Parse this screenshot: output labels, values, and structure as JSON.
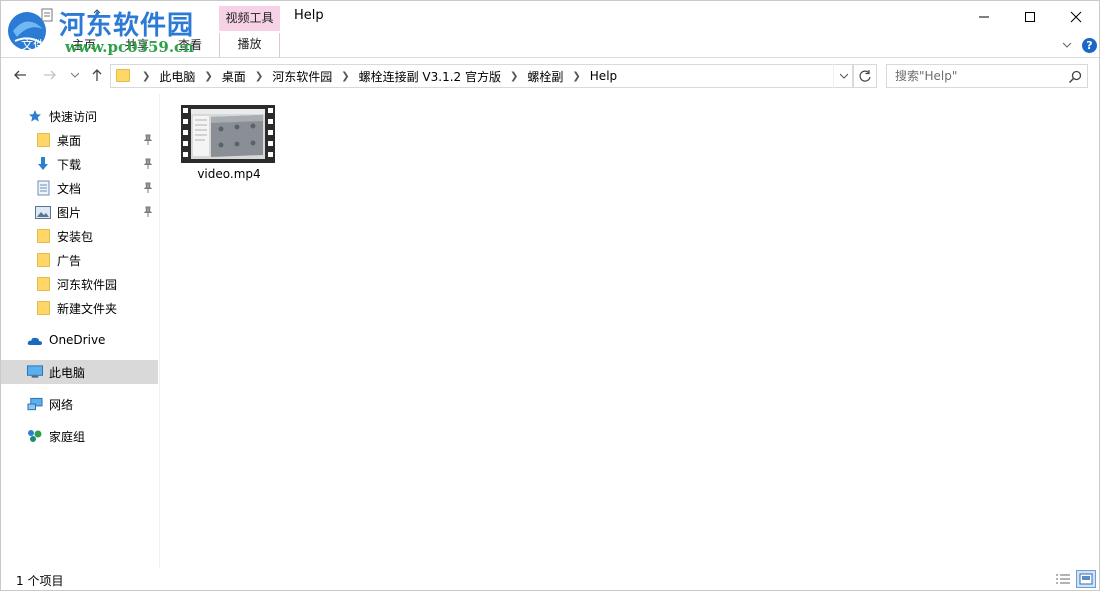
{
  "window": {
    "title": "Help",
    "context_tab_group": "视频工具",
    "watermark": {
      "name": "河东软件园",
      "url": "www.pc0359.cn"
    }
  },
  "ribbon": {
    "tabs": [
      {
        "label": "文件"
      },
      {
        "label": "主页"
      },
      {
        "label": "共享"
      },
      {
        "label": "查看"
      },
      {
        "label": "播放"
      }
    ],
    "help_label": "?"
  },
  "address": {
    "crumbs": [
      "此电脑",
      "桌面",
      "河东软件园",
      "螺栓连接副 V3.1.2 官方版",
      "螺栓副",
      "Help"
    ]
  },
  "search": {
    "placeholder": "搜索\"Help\""
  },
  "nav_pane": {
    "quick_access": "快速访问",
    "quick_items": [
      {
        "label": "桌面",
        "icon": "desktop-folder-icon",
        "pinned": true
      },
      {
        "label": "下载",
        "icon": "download-arrow-icon",
        "pinned": true
      },
      {
        "label": "文档",
        "icon": "document-icon",
        "pinned": true
      },
      {
        "label": "图片",
        "icon": "picture-icon",
        "pinned": true
      },
      {
        "label": "安装包",
        "icon": "folder-icon",
        "pinned": false
      },
      {
        "label": "广告",
        "icon": "folder-icon",
        "pinned": false
      },
      {
        "label": "河东软件园",
        "icon": "folder-icon",
        "pinned": false
      },
      {
        "label": "新建文件夹",
        "icon": "folder-icon",
        "pinned": false
      }
    ],
    "onedrive": "OneDrive",
    "this_pc": "此电脑",
    "network": "网络",
    "homegroup": "家庭组"
  },
  "files": [
    {
      "name": "video.mp4",
      "icon": "video-thumbnail-icon"
    }
  ],
  "status": {
    "count": "1 个项目"
  },
  "colors": {
    "context_tab": "#f7d1e6",
    "selection": "#d9d9d9",
    "folder": "#ffd766",
    "accent": "#1b66c9"
  }
}
